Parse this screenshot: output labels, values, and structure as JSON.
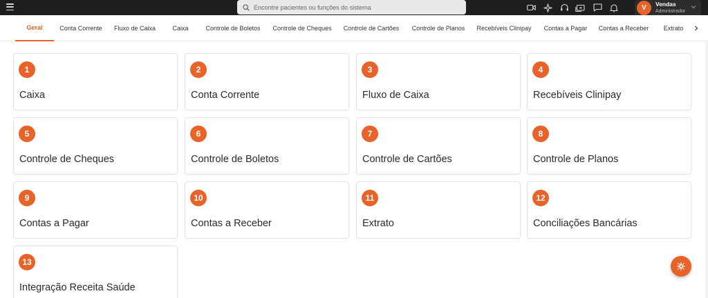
{
  "header": {
    "search_placeholder": "Encontre pacientes ou funções do sistema",
    "icons": [
      "menu-icon",
      "video-icon",
      "sparkle-icon",
      "headset-icon",
      "screen-share-icon",
      "chat-icon",
      "bell-icon"
    ],
    "user": {
      "initial": "V",
      "name": "Vendas",
      "role": "Administrador"
    }
  },
  "tabs": [
    {
      "label": "Geral",
      "active": true
    },
    {
      "label": "Conta Corrente"
    },
    {
      "label": "Fluxo de Caixa"
    },
    {
      "label": "Caixa"
    },
    {
      "label": "Controle de Boletos"
    },
    {
      "label": "Controle de Cheques"
    },
    {
      "label": "Controle de Cartões"
    },
    {
      "label": "Controle de Planos"
    },
    {
      "label": "Recebíveis Clinipay"
    },
    {
      "label": "Contas a Pagar"
    },
    {
      "label": "Contas a Receber"
    },
    {
      "label": "Extrato"
    }
  ],
  "cards": [
    {
      "number": "1",
      "title": "Caixa"
    },
    {
      "number": "2",
      "title": "Conta Corrente"
    },
    {
      "number": "3",
      "title": "Fluxo de Caixa"
    },
    {
      "number": "4",
      "title": "Recebíveis Clinipay"
    },
    {
      "number": "5",
      "title": "Controle de Cheques"
    },
    {
      "number": "6",
      "title": "Controle de Boletos"
    },
    {
      "number": "7",
      "title": "Controle de Cartões"
    },
    {
      "number": "8",
      "title": "Controle de Planos"
    },
    {
      "number": "9",
      "title": "Contas a Pagar"
    },
    {
      "number": "10",
      "title": "Contas a Receber"
    },
    {
      "number": "11",
      "title": "Extrato"
    },
    {
      "number": "12",
      "title": "Conciliações Bancárias"
    },
    {
      "number": "13",
      "title": "Integração Receita Saúde"
    }
  ],
  "colors": {
    "accent": "#e8632a",
    "topbar": "#1e1e1e"
  }
}
